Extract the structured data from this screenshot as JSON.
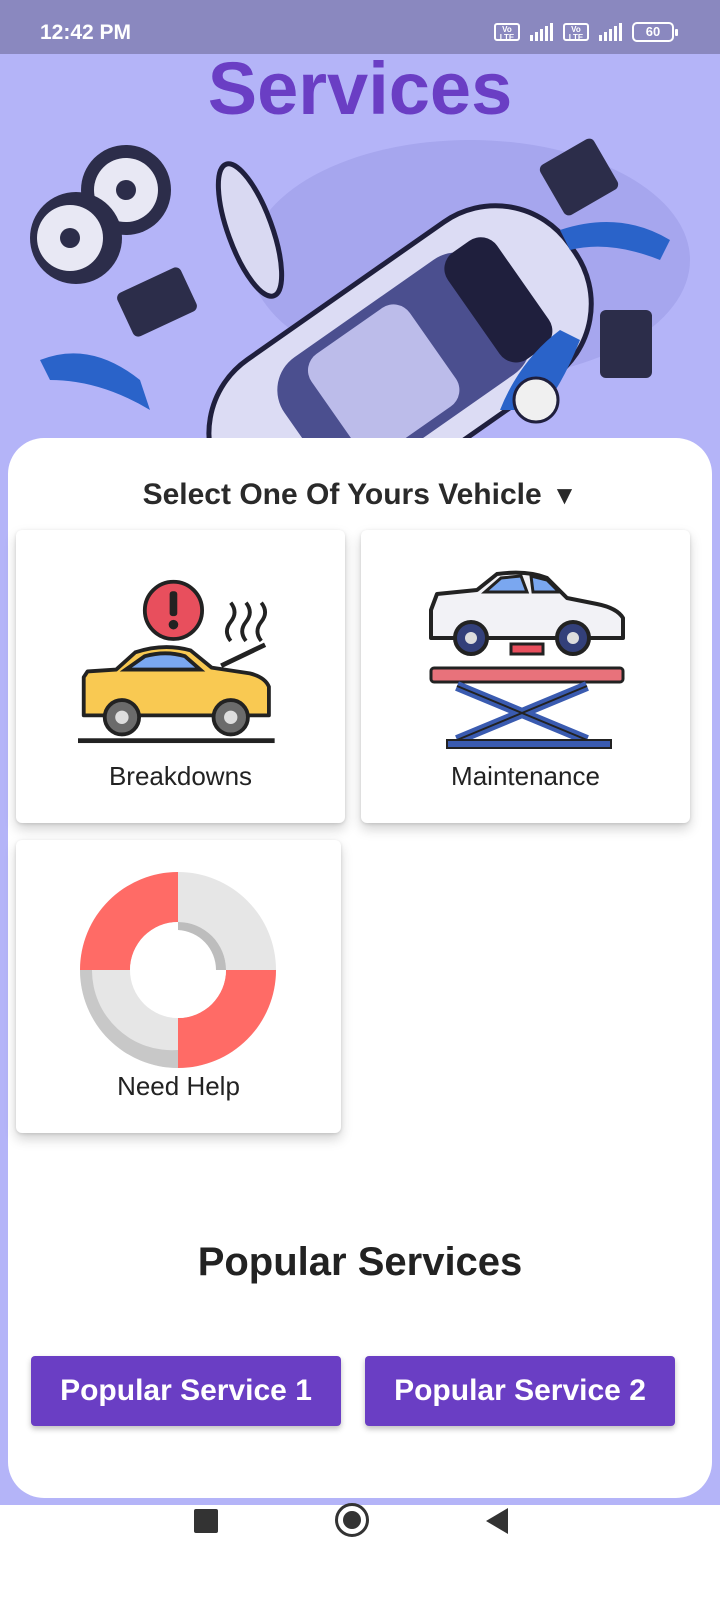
{
  "status_bar": {
    "time": "12:42 PM",
    "volte_label": "Vo LTE",
    "battery": "60"
  },
  "header": {
    "title": "Services"
  },
  "vehicle_select": {
    "label": "Select One Of Yours Vehicle",
    "arrow": "▼"
  },
  "cards": [
    {
      "label": "Breakdowns",
      "icon": "broken-car-icon"
    },
    {
      "label": "Maintenance",
      "icon": "car-lift-icon"
    },
    {
      "label": "Need Help",
      "icon": "lifebuoy-icon"
    }
  ],
  "popular": {
    "title": "Popular Services",
    "buttons": [
      "Popular Service 1",
      "Popular Service 2"
    ]
  },
  "colors": {
    "accent": "#6a3ec4",
    "background": "#b4b4f8",
    "status_bar": "#8a88bf"
  }
}
